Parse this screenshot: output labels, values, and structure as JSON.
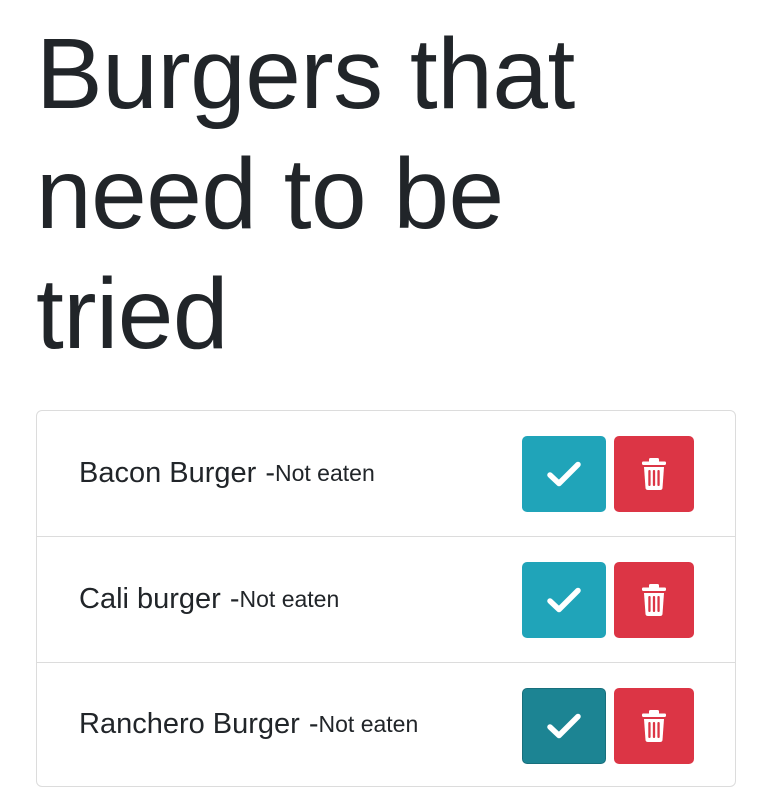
{
  "page": {
    "title": "Burgers that need to be tried"
  },
  "burgers": [
    {
      "name": "Bacon Burger",
      "separator": "-",
      "status": "Not eaten",
      "eat_icon": "check-icon",
      "delete_icon": "trash-icon"
    },
    {
      "name": "Cali burger",
      "separator": "-",
      "status": "Not eaten",
      "eat_icon": "check-icon",
      "delete_icon": "trash-icon"
    },
    {
      "name": "Ranchero Burger",
      "separator": "-",
      "status": "Not eaten",
      "eat_icon": "check-icon",
      "delete_icon": "trash-icon"
    }
  ],
  "colors": {
    "eat_button": "#20a4b9",
    "eat_button_active": "#1c8493",
    "delete_button": "#dc3545",
    "text": "#212529"
  }
}
